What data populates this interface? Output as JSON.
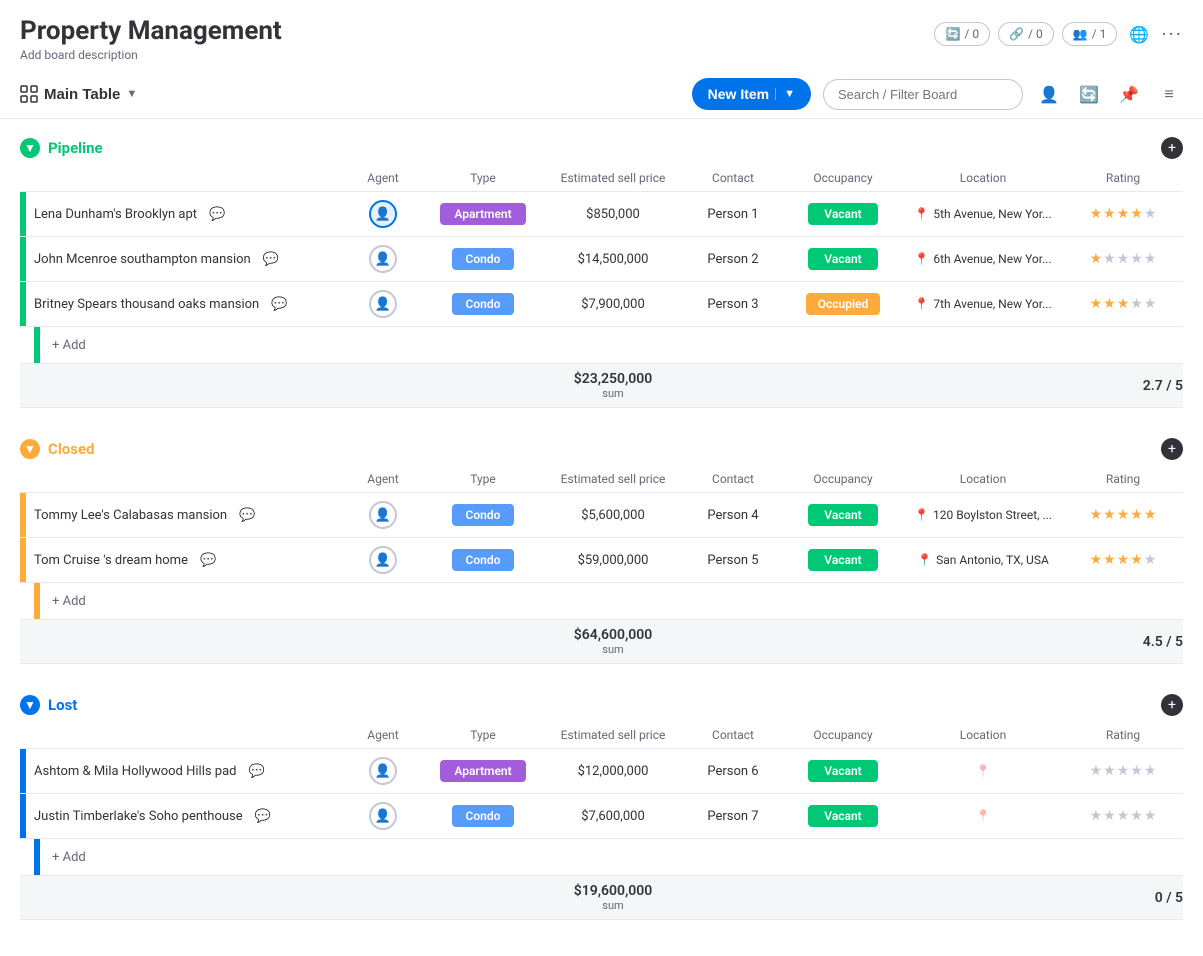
{
  "app": {
    "title": "Property Management",
    "description": "Add board description"
  },
  "topbar": {
    "stats": [
      {
        "icon": "search",
        "value": "/ 0"
      },
      {
        "icon": "link",
        "value": "/ 0"
      },
      {
        "icon": "people",
        "value": "/ 1"
      }
    ]
  },
  "toolbar": {
    "mainTable": "Main Table",
    "newItem": "New Item",
    "searchPlaceholder": "Search / Filter Board"
  },
  "groups": [
    {
      "id": "pipeline",
      "name": "Pipeline",
      "color": "#00c875",
      "toggleColor": "#00c875",
      "columns": [
        "Agent",
        "Type",
        "Estimated sell price",
        "Contact",
        "Occupancy",
        "Location",
        "Rating"
      ],
      "items": [
        {
          "name": "Lena Dunham's Brooklyn apt",
          "agentSelected": true,
          "type": "Apartment",
          "typeClass": "type-apartment",
          "price": "$850,000",
          "contact": "Person 1",
          "occupancy": "Vacant",
          "occupancyClass": "occupancy-vacant",
          "location": "5th Avenue, New Yor...",
          "locationPin": true,
          "rating": 4
        },
        {
          "name": "John Mcenroe southampton mansion",
          "agentSelected": false,
          "type": "Condo",
          "typeClass": "type-condo",
          "price": "$14,500,000",
          "contact": "Person 2",
          "occupancy": "Vacant",
          "occupancyClass": "occupancy-vacant",
          "location": "6th Avenue, New Yor...",
          "locationPin": true,
          "rating": 1
        },
        {
          "name": "Britney Spears thousand oaks mansion",
          "agentSelected": false,
          "type": "Condo",
          "typeClass": "type-condo",
          "price": "$7,900,000",
          "contact": "Person 3",
          "occupancy": "Occupied",
          "occupancyClass": "occupancy-occupied",
          "location": "7th Avenue, New Yor...",
          "locationPin": true,
          "rating": 3
        }
      ],
      "sumPrice": "$23,250,000",
      "sumRating": "2.7 / 5",
      "addLabel": "+ Add"
    },
    {
      "id": "closed",
      "name": "Closed",
      "color": "#fdab3d",
      "toggleColor": "#fdab3d",
      "columns": [
        "Agent",
        "Type",
        "Estimated sell price",
        "Contact",
        "Occupancy",
        "Location",
        "Rating"
      ],
      "items": [
        {
          "name": "Tommy Lee's Calabasas mansion",
          "agentSelected": false,
          "type": "Condo",
          "typeClass": "type-condo",
          "price": "$5,600,000",
          "contact": "Person 4",
          "occupancy": "Vacant",
          "occupancyClass": "occupancy-vacant",
          "location": "120 Boylston Street, ...",
          "locationPin": true,
          "rating": 5
        },
        {
          "name": "Tom Cruise 's dream home",
          "agentSelected": false,
          "type": "Condo",
          "typeClass": "type-condo",
          "price": "$59,000,000",
          "contact": "Person 5",
          "occupancy": "Vacant",
          "occupancyClass": "occupancy-vacant",
          "location": "San Antonio, TX, USA",
          "locationPin": true,
          "rating": 4
        }
      ],
      "sumPrice": "$64,600,000",
      "sumRating": "4.5 / 5",
      "addLabel": "+ Add"
    },
    {
      "id": "lost",
      "name": "Lost",
      "color": "#0073ea",
      "toggleColor": "#0073ea",
      "columns": [
        "Agent",
        "Type",
        "Estimated sell price",
        "Contact",
        "Occupancy",
        "Location",
        "Rating"
      ],
      "items": [
        {
          "name": "Ashtom & Mila Hollywood Hills pad",
          "agentSelected": false,
          "type": "Apartment",
          "typeClass": "type-apartment",
          "price": "$12,000,000",
          "contact": "Person 6",
          "occupancy": "Vacant",
          "occupancyClass": "occupancy-vacant",
          "location": "",
          "locationPin": false,
          "locationPinGray": true,
          "rating": 0
        },
        {
          "name": "Justin Timberlake's Soho penthouse",
          "agentSelected": false,
          "type": "Condo",
          "typeClass": "type-condo",
          "price": "$7,600,000",
          "contact": "Person 7",
          "occupancy": "Vacant",
          "occupancyClass": "occupancy-vacant",
          "location": "",
          "locationPin": false,
          "locationPinGray": true,
          "rating": 0
        }
      ],
      "sumPrice": "$19,600,000",
      "sumRating": "0 / 5",
      "addLabel": "+ Add"
    }
  ]
}
